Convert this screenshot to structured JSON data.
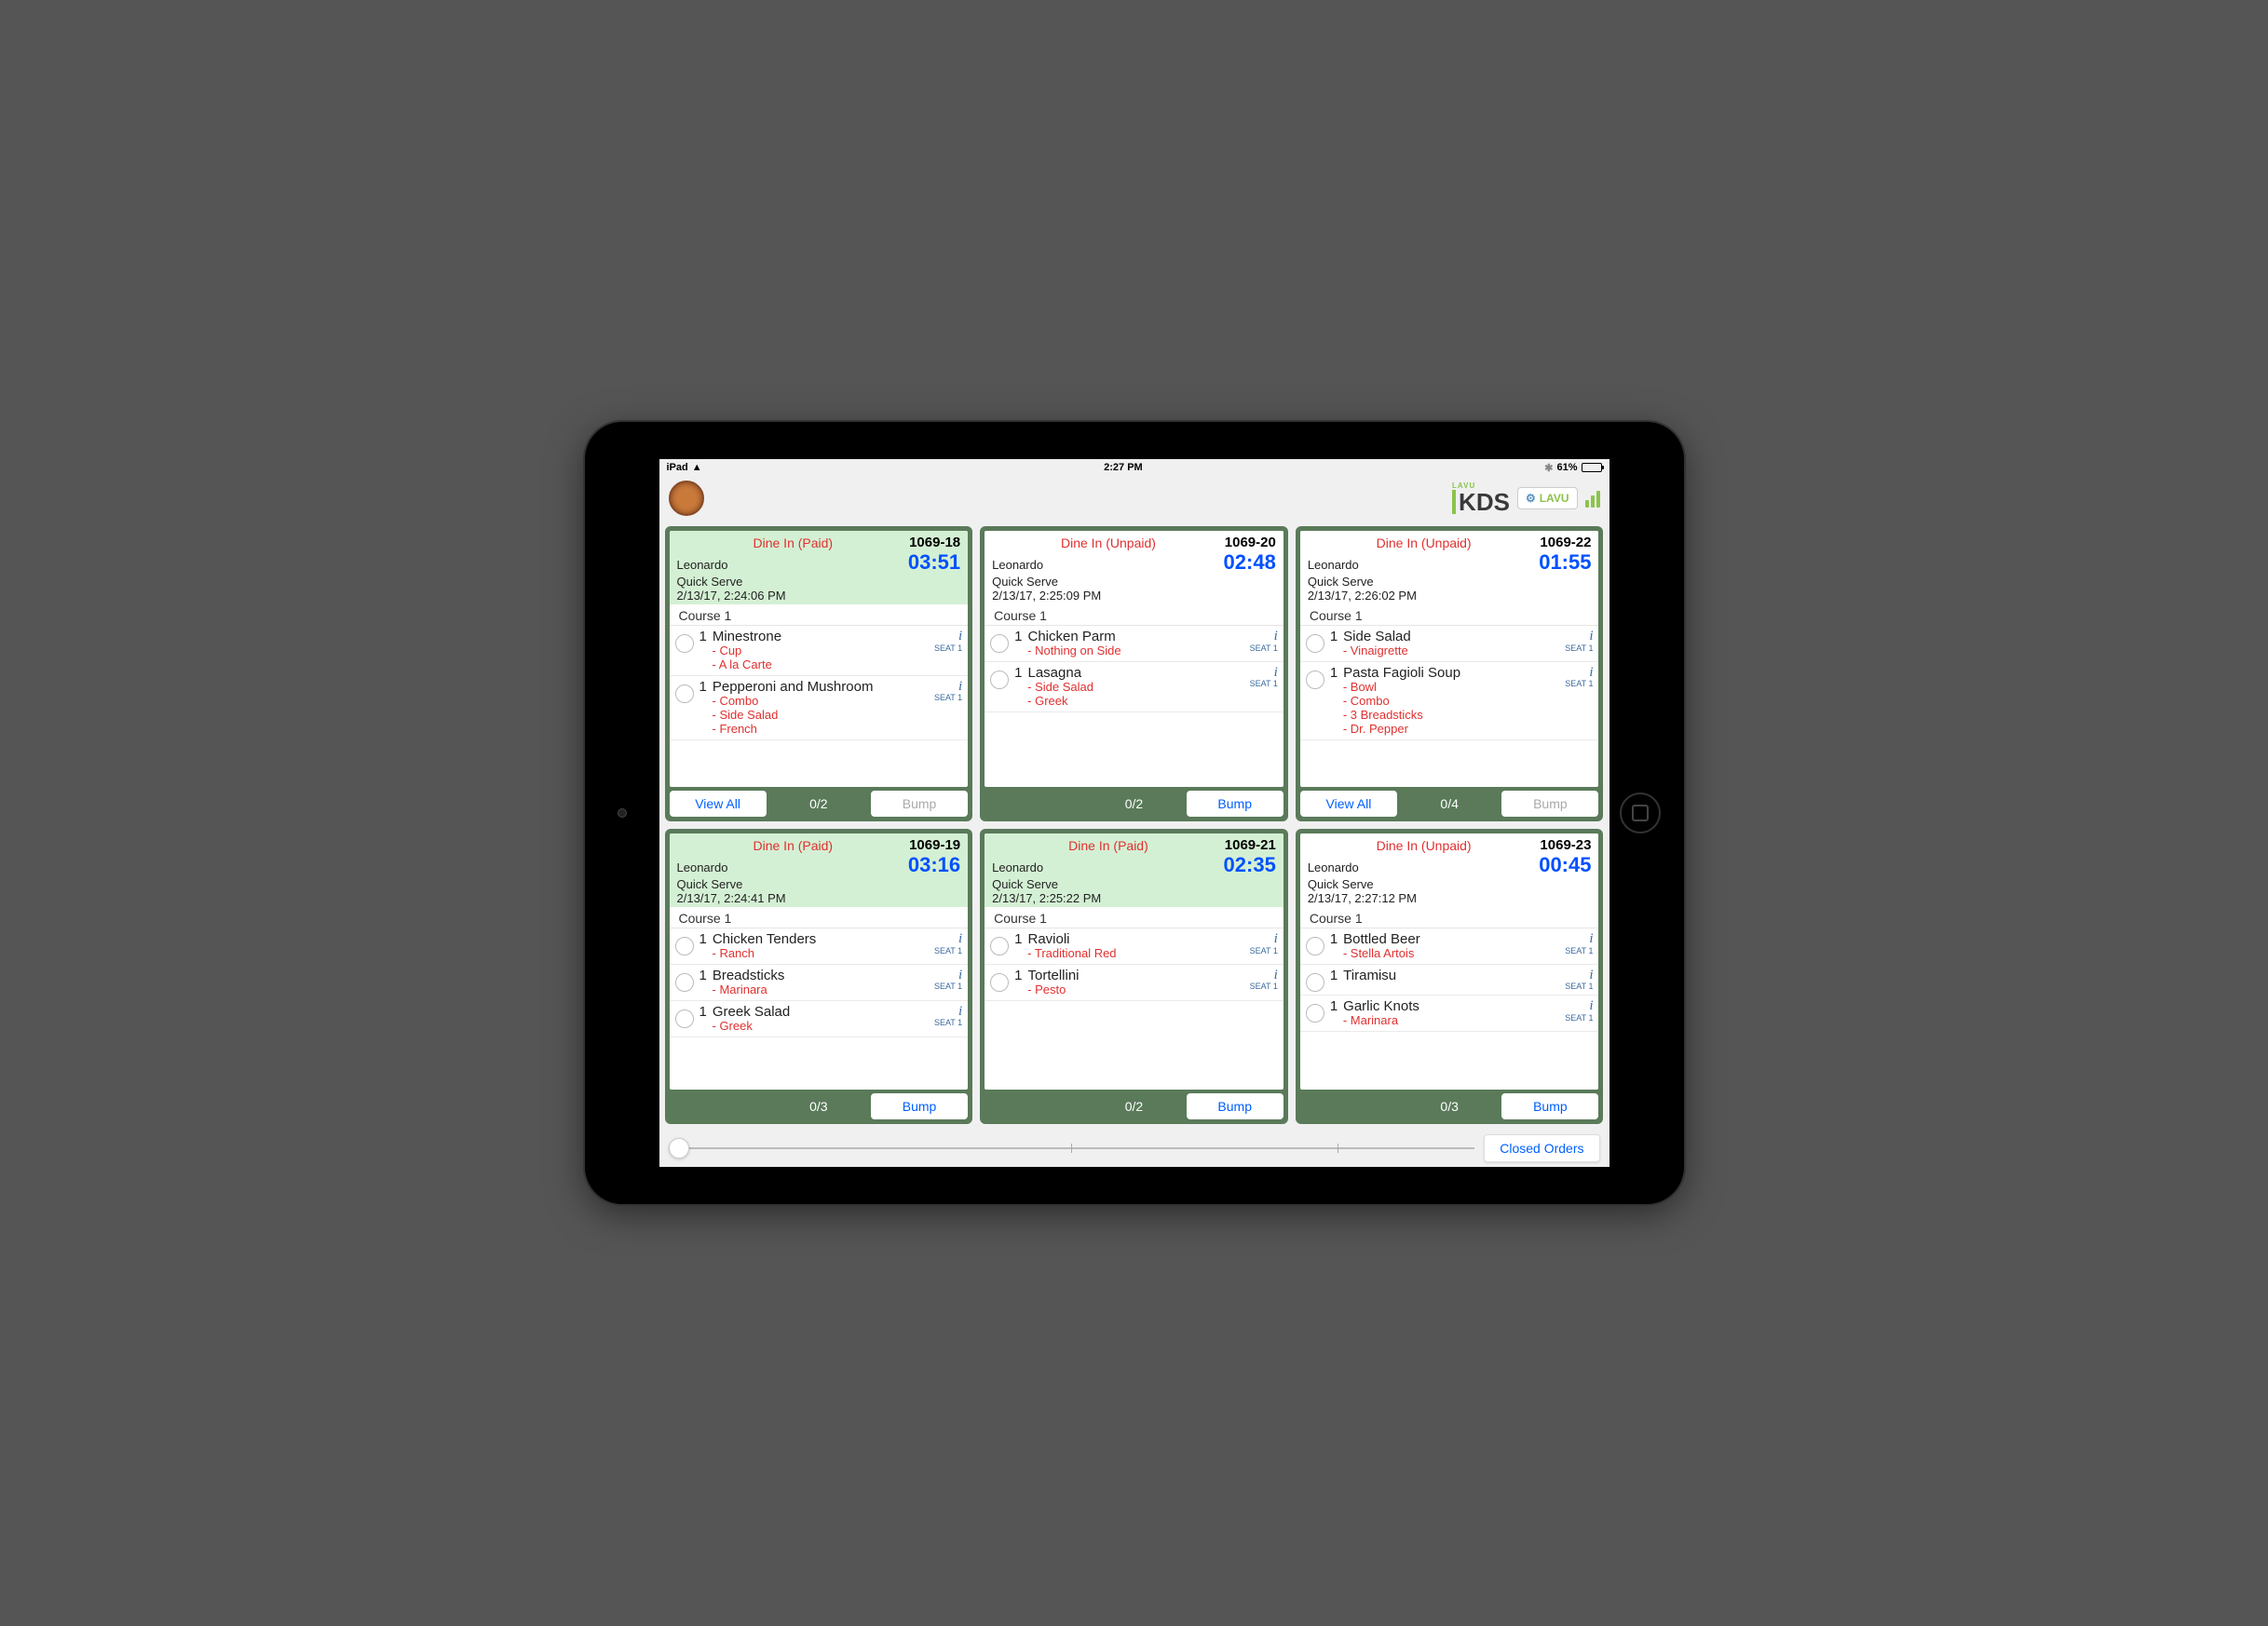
{
  "status_bar": {
    "device": "iPad",
    "time": "2:27 PM",
    "battery_pct": "61%"
  },
  "header": {
    "kds_brand_small": "LAVU",
    "kds_brand": "KDS",
    "lavu_btn": "LAVU"
  },
  "footer": {
    "closed_orders": "Closed Orders"
  },
  "common": {
    "course": "Course 1",
    "view_all": "View All",
    "bump": "Bump",
    "seat": "SEAT 1",
    "info": "i"
  },
  "tickets": [
    {
      "status": "Dine In (Paid)",
      "paid": true,
      "order": "1069-18",
      "server": "Leonardo",
      "timer": "03:51",
      "type": "Quick Serve",
      "ts": "2/13/17, 2:24:06 PM",
      "show_viewall": true,
      "count": "0/2",
      "bump_enabled": false,
      "items": [
        {
          "qty": "1",
          "name": "Minestrone",
          "mods": [
            "- Cup",
            "- A la Carte"
          ]
        },
        {
          "qty": "1",
          "name": "Pepperoni and Mushroom",
          "mods": [
            "- Combo",
            "- Side Salad",
            "- French"
          ]
        }
      ]
    },
    {
      "status": "Dine In (Unpaid)",
      "paid": false,
      "order": "1069-20",
      "server": "Leonardo",
      "timer": "02:48",
      "type": "Quick Serve",
      "ts": "2/13/17, 2:25:09 PM",
      "show_viewall": false,
      "count": "0/2",
      "bump_enabled": true,
      "items": [
        {
          "qty": "1",
          "name": "Chicken Parm",
          "mods": [
            "- Nothing on Side"
          ]
        },
        {
          "qty": "1",
          "name": "Lasagna",
          "mods": [
            "- Side Salad",
            "- Greek"
          ]
        }
      ]
    },
    {
      "status": "Dine In (Unpaid)",
      "paid": false,
      "order": "1069-22",
      "server": "Leonardo",
      "timer": "01:55",
      "type": "Quick Serve",
      "ts": "2/13/17, 2:26:02 PM",
      "show_viewall": true,
      "count": "0/4",
      "bump_enabled": false,
      "items": [
        {
          "qty": "1",
          "name": "Side Salad",
          "mods": [
            "- Vinaigrette"
          ]
        },
        {
          "qty": "1",
          "name": "Pasta Fagioli Soup",
          "mods": [
            "- Bowl",
            "- Combo",
            "- 3 Breadsticks",
            "- Dr. Pepper"
          ]
        }
      ]
    },
    {
      "status": "Dine In (Paid)",
      "paid": true,
      "order": "1069-19",
      "server": "Leonardo",
      "timer": "03:16",
      "type": "Quick Serve",
      "ts": "2/13/17, 2:24:41 PM",
      "show_viewall": false,
      "count": "0/3",
      "bump_enabled": true,
      "items": [
        {
          "qty": "1",
          "name": "Chicken Tenders",
          "mods": [
            "- Ranch"
          ]
        },
        {
          "qty": "1",
          "name": "Breadsticks",
          "mods": [
            "- Marinara"
          ]
        },
        {
          "qty": "1",
          "name": "Greek Salad",
          "mods": [
            "- Greek"
          ]
        }
      ]
    },
    {
      "status": "Dine In (Paid)",
      "paid": true,
      "order": "1069-21",
      "server": "Leonardo",
      "timer": "02:35",
      "type": "Quick Serve",
      "ts": "2/13/17, 2:25:22 PM",
      "show_viewall": false,
      "count": "0/2",
      "bump_enabled": true,
      "items": [
        {
          "qty": "1",
          "name": "Ravioli",
          "mods": [
            "- Traditional Red"
          ]
        },
        {
          "qty": "1",
          "name": "Tortellini",
          "mods": [
            "- Pesto"
          ]
        }
      ]
    },
    {
      "status": "Dine In (Unpaid)",
      "paid": false,
      "order": "1069-23",
      "server": "Leonardo",
      "timer": "00:45",
      "type": "Quick Serve",
      "ts": "2/13/17, 2:27:12 PM",
      "show_viewall": false,
      "count": "0/3",
      "bump_enabled": true,
      "items": [
        {
          "qty": "1",
          "name": "Bottled Beer",
          "mods": [
            "- Stella Artois"
          ]
        },
        {
          "qty": "1",
          "name": "Tiramisu",
          "mods": []
        },
        {
          "qty": "1",
          "name": "Garlic Knots",
          "mods": [
            "- Marinara"
          ]
        }
      ]
    }
  ]
}
